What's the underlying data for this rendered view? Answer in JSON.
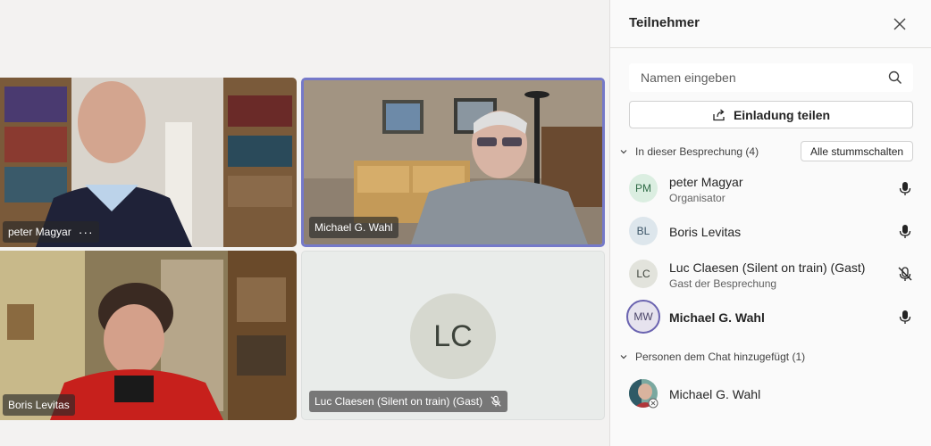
{
  "tiles": [
    {
      "name": "peter Magyar",
      "more": "···"
    },
    {
      "name": "Michael G. Wahl"
    },
    {
      "name": "Boris Levitas"
    },
    {
      "name": "Luc Claesen (Silent on train) (Gast)",
      "initials": "LC",
      "icon": "mic-off-icon"
    }
  ],
  "panel": {
    "title": "Teilnehmer",
    "close_icon": "close-icon",
    "search_placeholder": "Namen eingeben",
    "invite_label": "Einladung teilen",
    "section_meeting": "In dieser Besprechung (4)",
    "mute_all_label": "Alle stummschalten",
    "section_chat": "Personen dem Chat hinzugefügt (1)",
    "participants": [
      {
        "initials": "PM",
        "name": "peter Magyar",
        "role": "Organisator",
        "mic": "mic-icon",
        "avatar_bg": "#dbeee1",
        "avatar_fg": "#2f6b46"
      },
      {
        "initials": "BL",
        "name": "Boris Levitas",
        "role": "",
        "mic": "mic-icon",
        "avatar_bg": "#dde6ec",
        "avatar_fg": "#3b5466"
      },
      {
        "initials": "LC",
        "name": "Luc Claesen (Silent on train) (Gast)",
        "role": "Gast der Besprechung",
        "mic": "mic-off-icon",
        "avatar_bg": "#e2e3dc",
        "avatar_fg": "#3d433b"
      },
      {
        "initials": "MW",
        "name": "Michael G. Wahl",
        "role": "",
        "mic": "mic-icon",
        "avatar_bg": "#e6e3ee",
        "avatar_fg": "#4a4468"
      }
    ],
    "chat_person": {
      "name": "Michael G. Wahl"
    }
  }
}
